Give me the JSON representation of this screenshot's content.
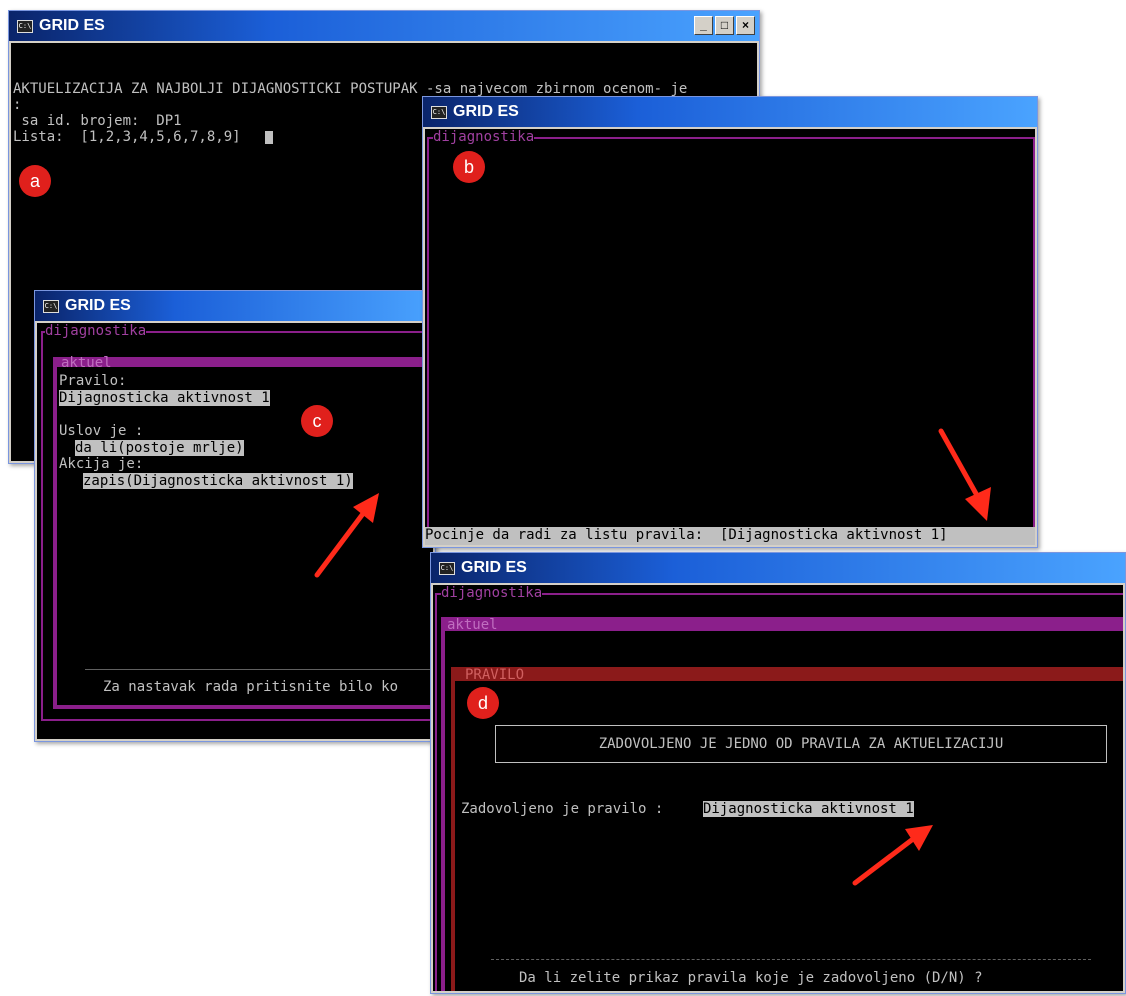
{
  "windows": {
    "a": {
      "title": "GRID ES",
      "line1": "AKTUELIZACIJA ZA NAJBOLJI DIJAGNOSTICKI POSTUPAK -sa najvecom zbirnom ocenom- je",
      "line2": ":",
      "line3": " sa id. brojem:  DP1",
      "line4": "Lista:  [1,2,3,4,5,6,7,8,9]",
      "badge": "a"
    },
    "b": {
      "title": "GRID ES",
      "frame_label": "dijagnostika",
      "badge": "b",
      "status": "Pocinje da radi za listu pravila:  [Dijagnosticka aktivnost 1]"
    },
    "c": {
      "title": "GRID ES",
      "frame_label": "dijagnostika",
      "inner_label": "aktuel",
      "pravilo_label": "Pravilo:",
      "pravilo_value": "Dijagnosticka aktivnost 1",
      "uslov_label": "Uslov je :",
      "uslov_value": "da li(postoje mrlje)",
      "akcija_label": "Akcija je:",
      "akcija_value": "zapis(Dijagnosticka aktivnost 1)",
      "badge": "c",
      "footer": "Za nastavak rada pritisnite bilo ko"
    },
    "d": {
      "title": "GRID ES",
      "frame_label": "dijagnostika",
      "inner_label": "aktuel",
      "rule_label": "PRAVILO",
      "badge": "d",
      "header_box": "ZADOVOLJENO JE JEDNO OD PRAVILA ZA AKTUELIZACIJU",
      "satisfied_label": "Zadovoljeno je pravilo : ",
      "satisfied_value": "Dijagnosticka aktivnost 1",
      "prompt": "Da li zelite prikaz pravila koje je zadovoljeno (D/N) ?"
    }
  },
  "window_controls": {
    "minimize": "_",
    "maximize": "□",
    "close": "×"
  },
  "colors": {
    "titlebar": "#0a246a",
    "purple": "#8b1f8b",
    "dark_red": "#8b1a1a",
    "badge": "#e0201c",
    "arrow": "#ff2a1a"
  }
}
